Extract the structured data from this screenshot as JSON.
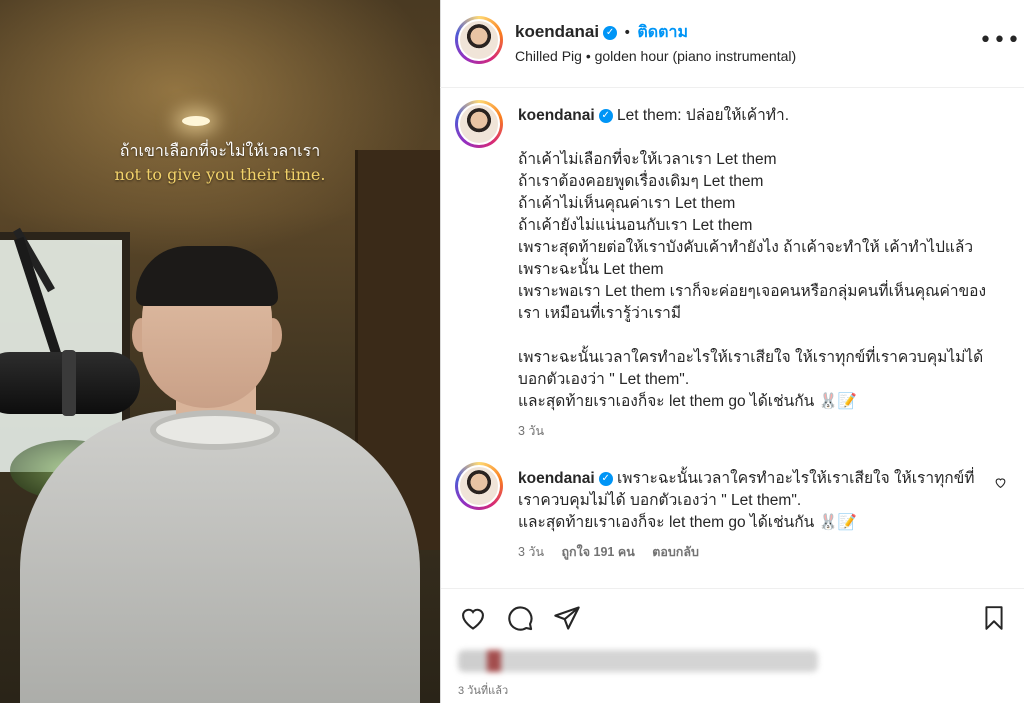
{
  "media": {
    "caption_thai": "ถ้าเขาเลือกที่จะไม่ให้เวลาเรา",
    "caption_english": "not to give you their time."
  },
  "header": {
    "username": "koendanai",
    "verified_icon": "verified-badge-icon",
    "follow_label": "ติดตาม",
    "audio": "Chilled Pig • golden hour (piano instrumental)",
    "more_icon": "more-options-icon"
  },
  "post": {
    "username": "koendanai",
    "first_line": "Let them: ปล่อยให้เค้าทำ.",
    "lines": [
      "ถ้าเค้าไม่เลือกที่จะให้เวลาเรา Let them",
      "ถ้าเราต้องคอยพูดเรื่องเดิมๆ Let them",
      "ถ้าเค้าไม่เห็นคุณค่าเรา Let them",
      "ถ้าเค้ายังไม่แน่นอนกับเรา Let them",
      "เพราะสุดท้ายต่อให้เราบังคับเค้าทำยังไง ถ้าเค้าจะทำให้ เค้าทำไปแล้ว",
      "เพราะฉะนั้น Let them",
      "เพราะพอเรา Let them เราก็จะค่อยๆเจอคนหรือกลุ่มคนที่เห็นคุณค่าของ",
      "เรา เหมือนที่เรารู้ว่าเรามี"
    ],
    "lines2": [
      "เพราะฉะนั้นเวลาใครทำอะไรให้เราเสียใจ ให้เราทุกข์ที่เราควบคุมไม่ได้",
      "บอกตัวเองว่า \" Let them\".",
      "และสุดท้ายเราเองก็จะ let them go ได้เช่นกัน 🐰📝"
    ],
    "time": "3 วัน"
  },
  "comment": {
    "username": "koendanai",
    "lines": [
      "เพราะฉะนั้นเวลาใครทำอะไรให้เราเสียใจ ให้เราทุกข์ที่",
      "เราควบคุมไม่ได้ บอกตัวเองว่า \" Let them\".",
      "และสุดท้ายเราเองก็จะ let them go ได้เช่นกัน 🐰📝"
    ],
    "time": "3 วัน",
    "likes": "ถูกใจ 191 คน",
    "reply": "ตอบกลับ",
    "like_icon": "heart-outline-icon"
  },
  "actions": {
    "like_icon": "heart-icon",
    "comment_icon": "comment-icon",
    "share_icon": "share-icon",
    "save_icon": "bookmark-icon"
  },
  "footer": {
    "time_ago": "3 วันที่แล้ว"
  }
}
